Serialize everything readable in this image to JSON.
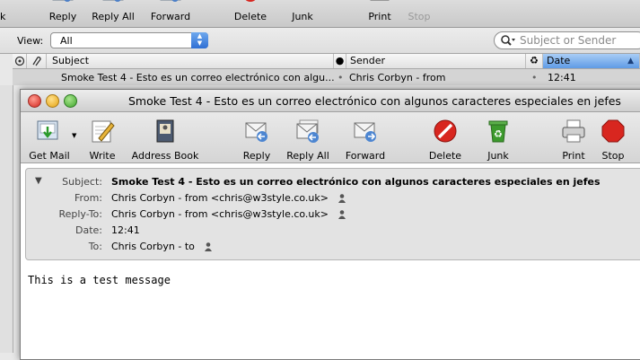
{
  "main_window": {
    "toolbar": {
      "edge_fragment": "k",
      "buttons": [
        {
          "label": "Reply",
          "icon": "reply-icon"
        },
        {
          "label": "Reply All",
          "icon": "reply-all-icon"
        },
        {
          "label": "Forward",
          "icon": "forward-icon"
        },
        {
          "label": "Delete",
          "icon": "delete-icon"
        },
        {
          "label": "Junk",
          "icon": "junk-icon"
        },
        {
          "label": "Print",
          "icon": "print-icon"
        },
        {
          "label": "Stop",
          "icon": "stop-icon",
          "disabled": true
        }
      ]
    },
    "view": {
      "label": "View:",
      "selected": "All"
    },
    "search": {
      "placeholder": "Subject or Sender"
    },
    "columns": {
      "subject": "Subject",
      "sender": "Sender",
      "date": "Date"
    },
    "message_row": {
      "subject": "Smoke Test 4 - Esto es un correo electrónico con algu...",
      "sender": "Chris Corbyn - from",
      "date": "12:41"
    }
  },
  "message_window": {
    "title": "Smoke Test 4 - Esto es un correo electrónico con algunos caracteres especiales en jefes",
    "toolbar": [
      {
        "label": "Get Mail",
        "icon": "get-mail-icon"
      },
      {
        "label": "Write",
        "icon": "write-icon"
      },
      {
        "label": "Address Book",
        "icon": "address-book-icon"
      },
      {
        "label": "Reply",
        "icon": "reply-icon"
      },
      {
        "label": "Reply All",
        "icon": "reply-all-icon"
      },
      {
        "label": "Forward",
        "icon": "forward-icon"
      },
      {
        "label": "Delete",
        "icon": "delete-icon"
      },
      {
        "label": "Junk",
        "icon": "junk-icon"
      },
      {
        "label": "Print",
        "icon": "print-icon"
      },
      {
        "label": "Stop",
        "icon": "stop-icon"
      }
    ],
    "headers": {
      "subject_label": "Subject:",
      "subject": "Smoke Test 4 - Esto es un correo electrónico con algunos caracteres especiales en jefes",
      "from_label": "From:",
      "from": "Chris Corbyn - from <chris@w3style.co.uk>",
      "reply_to_label": "Reply-To:",
      "reply_to": "Chris Corbyn - from <chris@w3style.co.uk>",
      "date_label": "Date:",
      "date": "12:41",
      "to_label": "To:",
      "to": "Chris Corbyn - to"
    },
    "body": "This is a test message"
  },
  "colors": {
    "selection_blue": "#5f9be6",
    "delete_red": "#d8261f",
    "junk_green": "#3c9a2d"
  }
}
